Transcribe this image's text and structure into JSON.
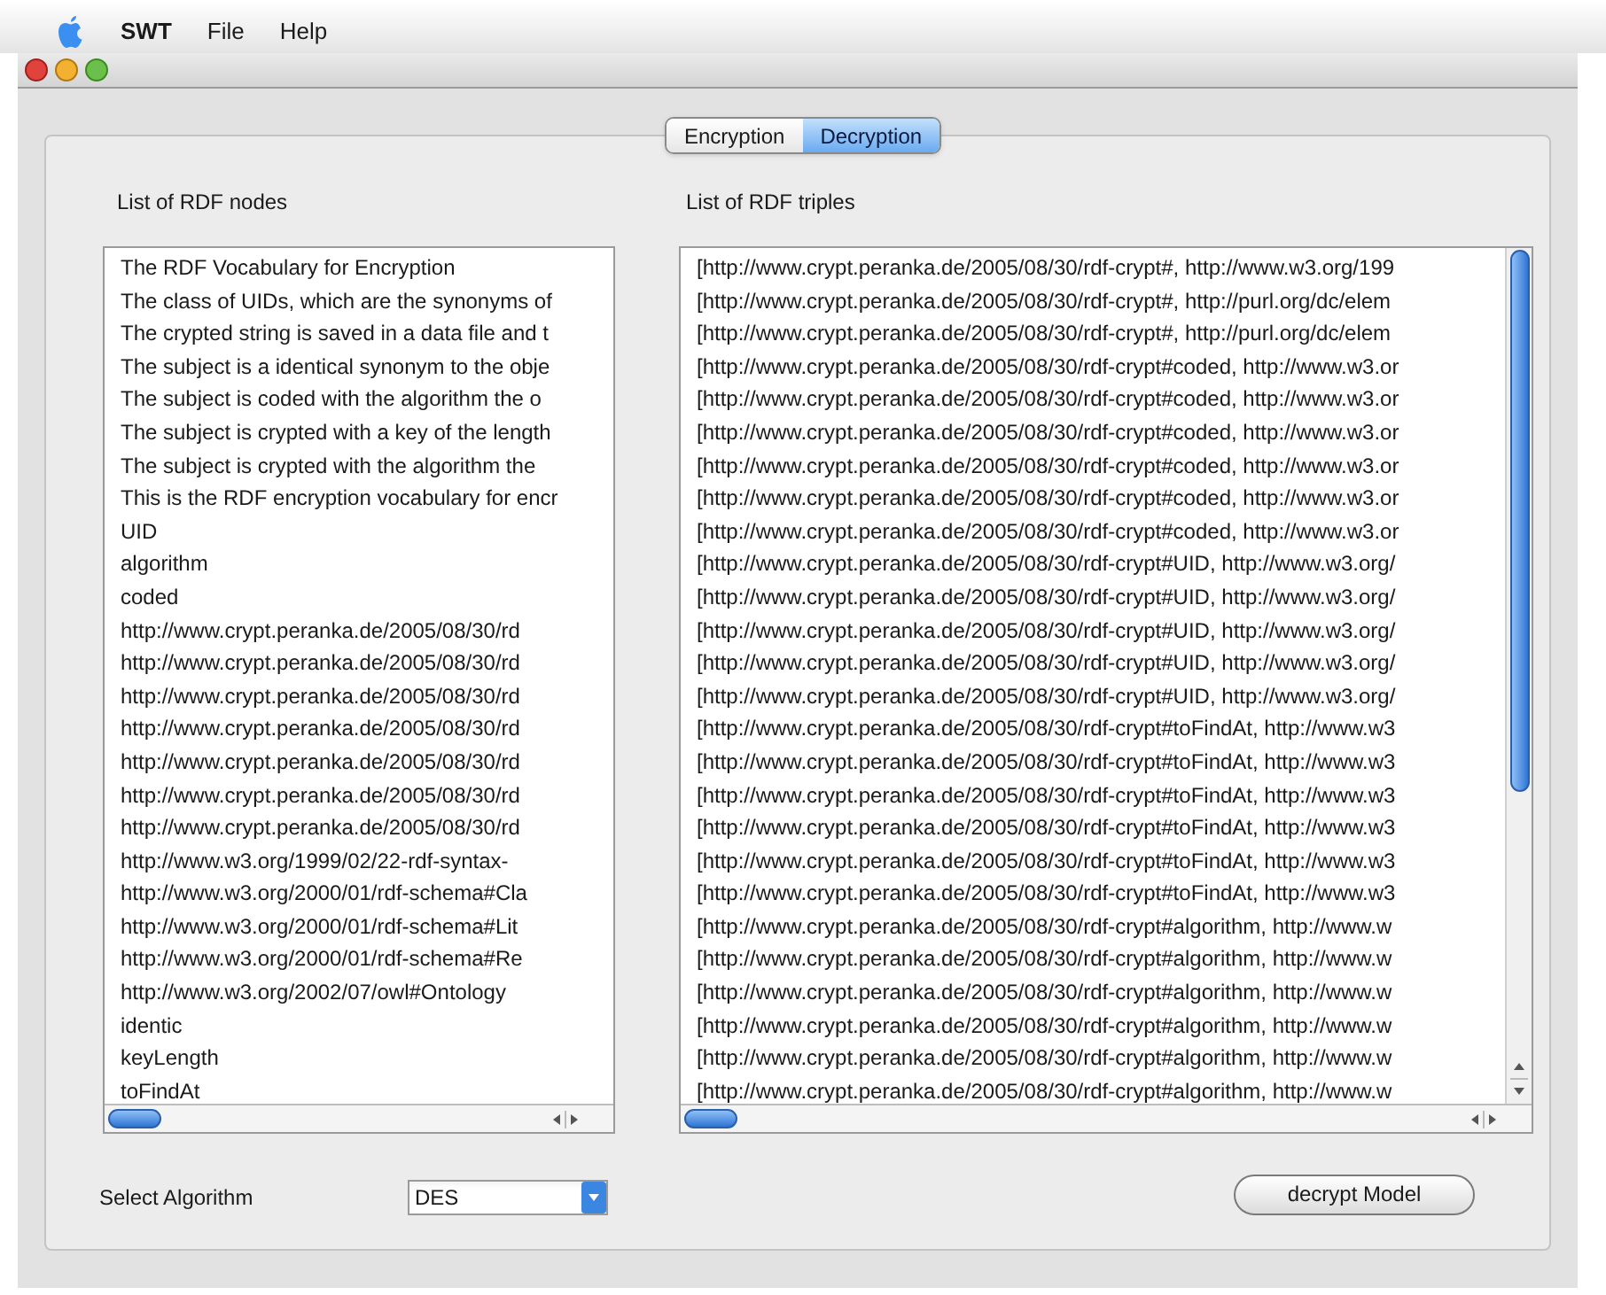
{
  "menu_bar": {
    "app": "SWT",
    "items": [
      "File",
      "Help"
    ]
  },
  "tabs": [
    {
      "label": "Encryption",
      "selected": false
    },
    {
      "label": "Decryption",
      "selected": true
    }
  ],
  "nodes_list": {
    "title": "List of RDF nodes",
    "items": [
      "The RDF Vocabulary for Encryption",
      "The class of UIDs, which are the synonyms of",
      "The crypted string is saved in a data file and t",
      "The subject is a identical synonym to the obje",
      "The subject is coded with the algorithm the o",
      "The subject is crypted with a key of the length",
      "The subject is crypted with the algorithm the",
      "This is the RDF encryption vocabulary for encr",
      "UID",
      "algorithm",
      "coded",
      "http://www.crypt.peranka.de/2005/08/30/rd",
      "http://www.crypt.peranka.de/2005/08/30/rd",
      "http://www.crypt.peranka.de/2005/08/30/rd",
      "http://www.crypt.peranka.de/2005/08/30/rd",
      "http://www.crypt.peranka.de/2005/08/30/rd",
      "http://www.crypt.peranka.de/2005/08/30/rd",
      "http://www.crypt.peranka.de/2005/08/30/rd",
      "http://www.w3.org/1999/02/22-rdf-syntax-",
      "http://www.w3.org/2000/01/rdf-schema#Cla",
      "http://www.w3.org/2000/01/rdf-schema#Lit",
      "http://www.w3.org/2000/01/rdf-schema#Re",
      "http://www.w3.org/2002/07/owl#Ontology",
      "identic",
      "keyLength",
      "toFindAt"
    ]
  },
  "triples_list": {
    "title": "List of RDF triples",
    "items": [
      "[http://www.crypt.peranka.de/2005/08/30/rdf-crypt#, http://www.w3.org/199",
      "[http://www.crypt.peranka.de/2005/08/30/rdf-crypt#, http://purl.org/dc/elem",
      "[http://www.crypt.peranka.de/2005/08/30/rdf-crypt#, http://purl.org/dc/elem",
      "[http://www.crypt.peranka.de/2005/08/30/rdf-crypt#coded, http://www.w3.or",
      "[http://www.crypt.peranka.de/2005/08/30/rdf-crypt#coded, http://www.w3.or",
      "[http://www.crypt.peranka.de/2005/08/30/rdf-crypt#coded, http://www.w3.or",
      "[http://www.crypt.peranka.de/2005/08/30/rdf-crypt#coded, http://www.w3.or",
      "[http://www.crypt.peranka.de/2005/08/30/rdf-crypt#coded, http://www.w3.or",
      "[http://www.crypt.peranka.de/2005/08/30/rdf-crypt#coded, http://www.w3.or",
      "[http://www.crypt.peranka.de/2005/08/30/rdf-crypt#UID, http://www.w3.org/",
      "[http://www.crypt.peranka.de/2005/08/30/rdf-crypt#UID, http://www.w3.org/",
      "[http://www.crypt.peranka.de/2005/08/30/rdf-crypt#UID, http://www.w3.org/",
      "[http://www.crypt.peranka.de/2005/08/30/rdf-crypt#UID, http://www.w3.org/",
      "[http://www.crypt.peranka.de/2005/08/30/rdf-crypt#UID, http://www.w3.org/",
      "[http://www.crypt.peranka.de/2005/08/30/rdf-crypt#toFindAt, http://www.w3",
      "[http://www.crypt.peranka.de/2005/08/30/rdf-crypt#toFindAt, http://www.w3",
      "[http://www.crypt.peranka.de/2005/08/30/rdf-crypt#toFindAt, http://www.w3",
      "[http://www.crypt.peranka.de/2005/08/30/rdf-crypt#toFindAt, http://www.w3",
      "[http://www.crypt.peranka.de/2005/08/30/rdf-crypt#toFindAt, http://www.w3",
      "[http://www.crypt.peranka.de/2005/08/30/rdf-crypt#toFindAt, http://www.w3",
      "[http://www.crypt.peranka.de/2005/08/30/rdf-crypt#algorithm, http://www.w",
      "[http://www.crypt.peranka.de/2005/08/30/rdf-crypt#algorithm, http://www.w",
      "[http://www.crypt.peranka.de/2005/08/30/rdf-crypt#algorithm, http://www.w",
      "[http://www.crypt.peranka.de/2005/08/30/rdf-crypt#algorithm, http://www.w",
      "[http://www.crypt.peranka.de/2005/08/30/rdf-crypt#algorithm, http://www.w",
      "[http://www.crypt.peranka.de/2005/08/30/rdf-crypt#algorithm, http://www.w"
    ]
  },
  "algorithm_select": {
    "label": "Select Algorithm",
    "value": "DES"
  },
  "decrypt_button": {
    "label": "decrypt Model"
  }
}
